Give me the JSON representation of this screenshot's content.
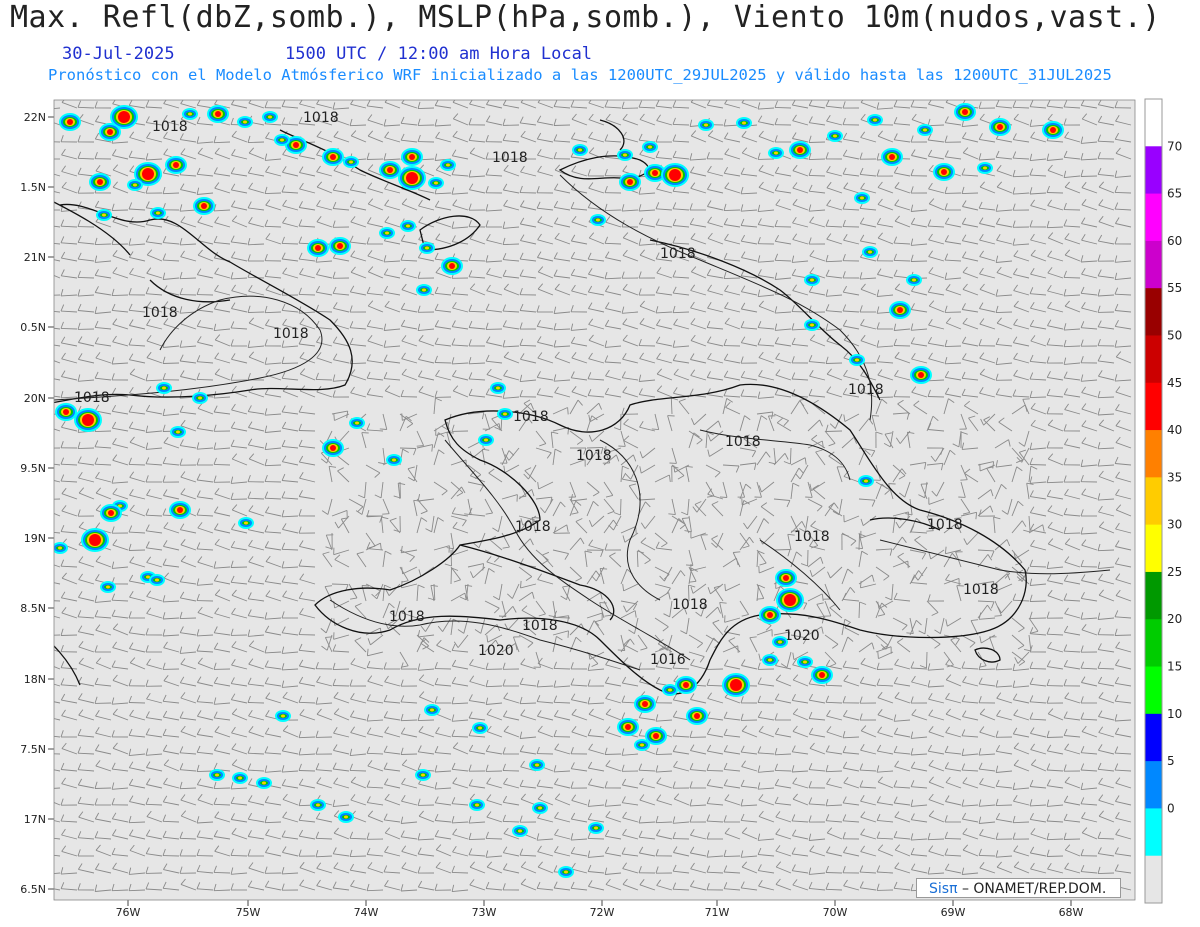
{
  "header": {
    "title": "Max. Refl(dbZ,somb.), MSLP(hPa,somb.), Viento 10m(nudos,vast.)",
    "date": "30-Jul-2025",
    "time": "1500 UTC / 12:00 am Hora Local",
    "description": "Pronóstico con el Modelo Atmósferico WRF inicializado a las 1200UTC_29JUL2025 y válido hasta las  1200UTC_31JUL2025"
  },
  "map": {
    "lat_labels": [
      "22N",
      "1.5N",
      "21N",
      "0.5N",
      "20N",
      "9.5N",
      "19N",
      "8.5N",
      "18N",
      "7.5N",
      "17N",
      "6.5N"
    ],
    "lon_labels": [
      "76W",
      "75W",
      "74W",
      "73W",
      "72W",
      "71W",
      "70W",
      "69W",
      "68W"
    ],
    "isobar_labels": [
      "1018",
      "1018",
      "1018",
      "1018",
      "1018",
      "1018",
      "1018",
      "1018",
      "1018",
      "1018",
      "1018",
      "1018",
      "1018",
      "1018",
      "1018",
      "1018",
      "1018",
      "1018",
      "1020",
      "1020",
      "1016"
    ],
    "background_color": "#e6e6e6"
  },
  "colorbar": {
    "ticks": [
      "70",
      "65",
      "60",
      "55",
      "50",
      "45",
      "40",
      "35",
      "30",
      "25",
      "20",
      "15",
      "10",
      "5",
      "0"
    ],
    "colors": [
      "#ffffff",
      "#9900ff",
      "#ff00ff",
      "#cc00cc",
      "#990000",
      "#cc0000",
      "#ff0000",
      "#ff8000",
      "#ffcc00",
      "#ffff00",
      "#009900",
      "#00cc00",
      "#00ff00",
      "#0000ff",
      "#0088ff",
      "#00ffff",
      "#e6e6e6"
    ]
  },
  "footer": {
    "brand": "Sisπ",
    "credit": "– ONAMET/REP.DOM."
  }
}
